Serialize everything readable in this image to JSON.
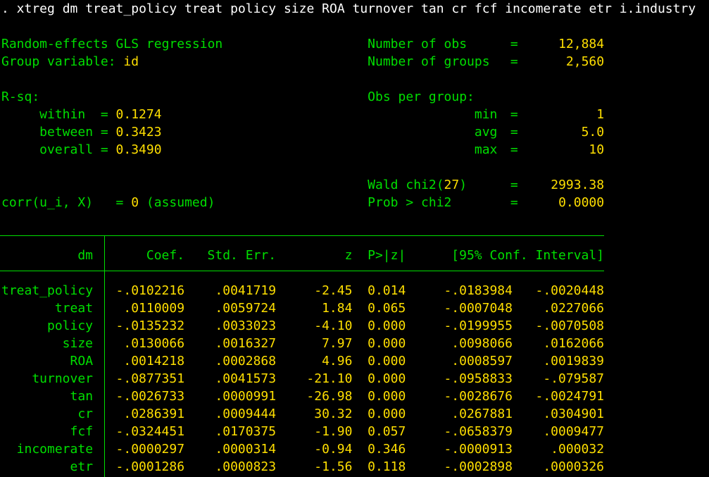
{
  "colors": {
    "background": "#000000",
    "green": "#00df00",
    "yellow": "#ffdf00",
    "white": "#ffffff"
  },
  "command": ". xtreg dm treat_policy treat policy size ROA turnover tan cr fcf incomerate etr i.industry",
  "symbols": {
    "eq": "="
  },
  "model": {
    "title": "Random-effects GLS regression",
    "group_label": "Group variable:",
    "group_value": "id",
    "corr_label": "corr(u_i, X)",
    "corr_zero": "0",
    "corr_note": "(assumed)"
  },
  "rsq": {
    "header": "R-sq:",
    "within": {
      "label": "within",
      "value": "0.1274"
    },
    "between": {
      "label": "between",
      "value": "0.3423"
    },
    "overall": {
      "label": "overall",
      "value": "0.3490"
    }
  },
  "right_stats": {
    "obs": {
      "label": "Number of obs",
      "value": "12,884"
    },
    "groups": {
      "label": "Number of groups",
      "value": "2,560"
    },
    "obs_per_group_header": "Obs per group:",
    "min": {
      "label": "min",
      "value": "1"
    },
    "avg": {
      "label": "avg",
      "value": "5.0"
    },
    "max": {
      "label": "max",
      "value": "10"
    },
    "wald": {
      "label_pre": "Wald chi2(",
      "df": "27",
      "label_post": ")",
      "value": "2993.38"
    },
    "prob": {
      "label": "Prob > chi2",
      "value": "0.0000"
    }
  },
  "table": {
    "header": {
      "depvar": "dm",
      "coef": "Coef.",
      "stderr": "Std. Err.",
      "z": "z",
      "p": "P>|z|",
      "ci": "[95% Conf. Interval]"
    },
    "rows": [
      {
        "name": "treat_policy",
        "coef": "-.0102216",
        "stderr": ".0041719",
        "z": "-2.45",
        "p": "0.014",
        "lo": "-.0183984",
        "hi": "-.0020448"
      },
      {
        "name": "treat",
        "coef": ".0110009",
        "stderr": ".0059724",
        "z": "1.84",
        "p": "0.065",
        "lo": "-.0007048",
        "hi": ".0227066"
      },
      {
        "name": "policy",
        "coef": "-.0135232",
        "stderr": ".0033023",
        "z": "-4.10",
        "p": "0.000",
        "lo": "-.0199955",
        "hi": "-.0070508"
      },
      {
        "name": "size",
        "coef": ".0130066",
        "stderr": ".0016327",
        "z": "7.97",
        "p": "0.000",
        "lo": ".0098066",
        "hi": ".0162066"
      },
      {
        "name": "ROA",
        "coef": ".0014218",
        "stderr": ".0002868",
        "z": "4.96",
        "p": "0.000",
        "lo": ".0008597",
        "hi": ".0019839"
      },
      {
        "name": "turnover",
        "coef": "-.0877351",
        "stderr": ".0041573",
        "z": "-21.10",
        "p": "0.000",
        "lo": "-.0958833",
        "hi": "-.079587"
      },
      {
        "name": "tan",
        "coef": "-.0026733",
        "stderr": ".0000991",
        "z": "-26.98",
        "p": "0.000",
        "lo": "-.0028676",
        "hi": "-.0024791"
      },
      {
        "name": "cr",
        "coef": ".0286391",
        "stderr": ".0009444",
        "z": "30.32",
        "p": "0.000",
        "lo": ".0267881",
        "hi": ".0304901"
      },
      {
        "name": "fcf",
        "coef": "-.0324451",
        "stderr": ".0170375",
        "z": "-1.90",
        "p": "0.057",
        "lo": "-.0658379",
        "hi": ".0009477"
      },
      {
        "name": "incomerate",
        "coef": "-.0000297",
        "stderr": ".0000314",
        "z": "-0.94",
        "p": "0.346",
        "lo": "-.0000913",
        "hi": ".000032"
      },
      {
        "name": "etr",
        "coef": "-.0001286",
        "stderr": ".0000823",
        "z": "-1.56",
        "p": "0.118",
        "lo": "-.0002898",
        "hi": ".0000326"
      }
    ]
  }
}
